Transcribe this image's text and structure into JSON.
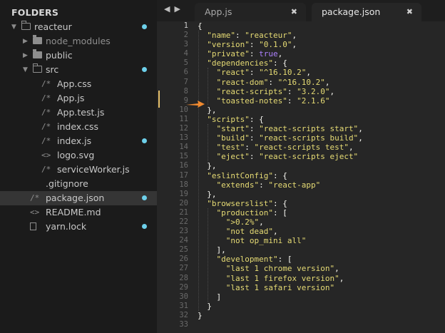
{
  "sidebar": {
    "title": "FOLDERS",
    "items": [
      {
        "label": "reacteur",
        "kind": "folder-open",
        "depth": 0,
        "dot": true,
        "arrow": "▼"
      },
      {
        "label": "node_modules",
        "kind": "folder",
        "depth": 1,
        "dot": false,
        "arrow": "▶",
        "dim": true
      },
      {
        "label": "public",
        "kind": "folder",
        "depth": 1,
        "dot": false,
        "arrow": "▶"
      },
      {
        "label": "src",
        "kind": "folder-open",
        "depth": 1,
        "dot": true,
        "arrow": "▼"
      },
      {
        "label": "App.css",
        "kind": "file",
        "icon": "/*",
        "depth": 2,
        "dot": false
      },
      {
        "label": "App.js",
        "kind": "file",
        "icon": "/*",
        "depth": 2,
        "dot": false
      },
      {
        "label": "App.test.js",
        "kind": "file",
        "icon": "/*",
        "depth": 2,
        "dot": false
      },
      {
        "label": "index.css",
        "kind": "file",
        "icon": "/*",
        "depth": 2,
        "dot": false
      },
      {
        "label": "index.js",
        "kind": "file",
        "icon": "/*",
        "depth": 2,
        "dot": true
      },
      {
        "label": "logo.svg",
        "kind": "file",
        "icon": "<>",
        "depth": 2,
        "dot": false
      },
      {
        "label": "serviceWorker.js",
        "kind": "file",
        "icon": "/*",
        "depth": 2,
        "dot": false
      },
      {
        "label": ".gitignore",
        "kind": "file",
        "icon": "",
        "depth": 1,
        "dot": false
      },
      {
        "label": "package.json",
        "kind": "file",
        "icon": "/*",
        "depth": 1,
        "dot": true,
        "selected": true
      },
      {
        "label": "README.md",
        "kind": "file",
        "icon": "<>",
        "depth": 1,
        "dot": false
      },
      {
        "label": "yarn.lock",
        "kind": "file",
        "icon": "doc",
        "depth": 1,
        "dot": true
      }
    ]
  },
  "nav": {
    "back": "◀",
    "forward": "▶"
  },
  "tabs": [
    {
      "label": "App.js",
      "close": "✖"
    },
    {
      "label": "package.json",
      "close": "✖"
    }
  ],
  "editor": {
    "current_line": 1,
    "lines": [
      [
        {
          "t": "{",
          "c": "p"
        }
      ],
      [
        {
          "t": "  ",
          "c": "p"
        },
        {
          "t": "\"name\"",
          "c": "s"
        },
        {
          "t": ": ",
          "c": "p"
        },
        {
          "t": "\"reacteur\"",
          "c": "s"
        },
        {
          "t": ",",
          "c": "p"
        }
      ],
      [
        {
          "t": "  ",
          "c": "p"
        },
        {
          "t": "\"version\"",
          "c": "s"
        },
        {
          "t": ": ",
          "c": "p"
        },
        {
          "t": "\"0.1.0\"",
          "c": "s"
        },
        {
          "t": ",",
          "c": "p"
        }
      ],
      [
        {
          "t": "  ",
          "c": "p"
        },
        {
          "t": "\"private\"",
          "c": "s"
        },
        {
          "t": ": ",
          "c": "p"
        },
        {
          "t": "true",
          "c": "b"
        },
        {
          "t": ",",
          "c": "p"
        }
      ],
      [
        {
          "t": "  ",
          "c": "p"
        },
        {
          "t": "\"dependencies\"",
          "c": "s"
        },
        {
          "t": ": {",
          "c": "p"
        }
      ],
      [
        {
          "t": "    ",
          "c": "p"
        },
        {
          "t": "\"react\"",
          "c": "s"
        },
        {
          "t": ": ",
          "c": "p"
        },
        {
          "t": "\"^16.10.2\"",
          "c": "s"
        },
        {
          "t": ",",
          "c": "p"
        }
      ],
      [
        {
          "t": "    ",
          "c": "p"
        },
        {
          "t": "\"react-dom\"",
          "c": "s"
        },
        {
          "t": ": ",
          "c": "p"
        },
        {
          "t": "\"^16.10.2\"",
          "c": "s"
        },
        {
          "t": ",",
          "c": "p"
        }
      ],
      [
        {
          "t": "    ",
          "c": "p"
        },
        {
          "t": "\"react-scripts\"",
          "c": "s"
        },
        {
          "t": ": ",
          "c": "p"
        },
        {
          "t": "\"3.2.0\"",
          "c": "s"
        },
        {
          "t": ",",
          "c": "p"
        }
      ],
      [
        {
          "t": "    ",
          "c": "p"
        },
        {
          "t": "\"toasted-notes\"",
          "c": "s"
        },
        {
          "t": ": ",
          "c": "p"
        },
        {
          "t": "\"2.1.6\"",
          "c": "s"
        }
      ],
      [
        {
          "t": "  },",
          "c": "p"
        }
      ],
      [
        {
          "t": "  ",
          "c": "p"
        },
        {
          "t": "\"scripts\"",
          "c": "s"
        },
        {
          "t": ": {",
          "c": "p"
        }
      ],
      [
        {
          "t": "    ",
          "c": "p"
        },
        {
          "t": "\"start\"",
          "c": "s"
        },
        {
          "t": ": ",
          "c": "p"
        },
        {
          "t": "\"react-scripts start\"",
          "c": "s"
        },
        {
          "t": ",",
          "c": "p"
        }
      ],
      [
        {
          "t": "    ",
          "c": "p"
        },
        {
          "t": "\"build\"",
          "c": "s"
        },
        {
          "t": ": ",
          "c": "p"
        },
        {
          "t": "\"react-scripts build\"",
          "c": "s"
        },
        {
          "t": ",",
          "c": "p"
        }
      ],
      [
        {
          "t": "    ",
          "c": "p"
        },
        {
          "t": "\"test\"",
          "c": "s"
        },
        {
          "t": ": ",
          "c": "p"
        },
        {
          "t": "\"react-scripts test\"",
          "c": "s"
        },
        {
          "t": ",",
          "c": "p"
        }
      ],
      [
        {
          "t": "    ",
          "c": "p"
        },
        {
          "t": "\"eject\"",
          "c": "s"
        },
        {
          "t": ": ",
          "c": "p"
        },
        {
          "t": "\"react-scripts eject\"",
          "c": "s"
        }
      ],
      [
        {
          "t": "  },",
          "c": "p"
        }
      ],
      [
        {
          "t": "  ",
          "c": "p"
        },
        {
          "t": "\"eslintConfig\"",
          "c": "s"
        },
        {
          "t": ": {",
          "c": "p"
        }
      ],
      [
        {
          "t": "    ",
          "c": "p"
        },
        {
          "t": "\"extends\"",
          "c": "s"
        },
        {
          "t": ": ",
          "c": "p"
        },
        {
          "t": "\"react-app\"",
          "c": "s"
        }
      ],
      [
        {
          "t": "  },",
          "c": "p"
        }
      ],
      [
        {
          "t": "  ",
          "c": "p"
        },
        {
          "t": "\"browserslist\"",
          "c": "s"
        },
        {
          "t": ": {",
          "c": "p"
        }
      ],
      [
        {
          "t": "    ",
          "c": "p"
        },
        {
          "t": "\"production\"",
          "c": "s"
        },
        {
          "t": ": [",
          "c": "p"
        }
      ],
      [
        {
          "t": "      ",
          "c": "p"
        },
        {
          "t": "\">0.2%\"",
          "c": "s"
        },
        {
          "t": ",",
          "c": "p"
        }
      ],
      [
        {
          "t": "      ",
          "c": "p"
        },
        {
          "t": "\"not dead\"",
          "c": "s"
        },
        {
          "t": ",",
          "c": "p"
        }
      ],
      [
        {
          "t": "      ",
          "c": "p"
        },
        {
          "t": "\"not op_mini all\"",
          "c": "s"
        }
      ],
      [
        {
          "t": "    ],",
          "c": "p"
        }
      ],
      [
        {
          "t": "    ",
          "c": "p"
        },
        {
          "t": "\"development\"",
          "c": "s"
        },
        {
          "t": ": [",
          "c": "p"
        }
      ],
      [
        {
          "t": "      ",
          "c": "p"
        },
        {
          "t": "\"last 1 chrome version\"",
          "c": "s"
        },
        {
          "t": ",",
          "c": "p"
        }
      ],
      [
        {
          "t": "      ",
          "c": "p"
        },
        {
          "t": "\"last 1 firefox version\"",
          "c": "s"
        },
        {
          "t": ",",
          "c": "p"
        }
      ],
      [
        {
          "t": "      ",
          "c": "p"
        },
        {
          "t": "\"last 1 safari version\"",
          "c": "s"
        }
      ],
      [
        {
          "t": "    ]",
          "c": "p"
        }
      ],
      [
        {
          "t": "  }",
          "c": "p"
        }
      ],
      [
        {
          "t": "}",
          "c": "p"
        }
      ],
      []
    ]
  },
  "colors": {
    "accent_dot": "#6dd0ea",
    "annotation_arrow": "#f08a30",
    "modified_bar": "#e6c06a"
  }
}
